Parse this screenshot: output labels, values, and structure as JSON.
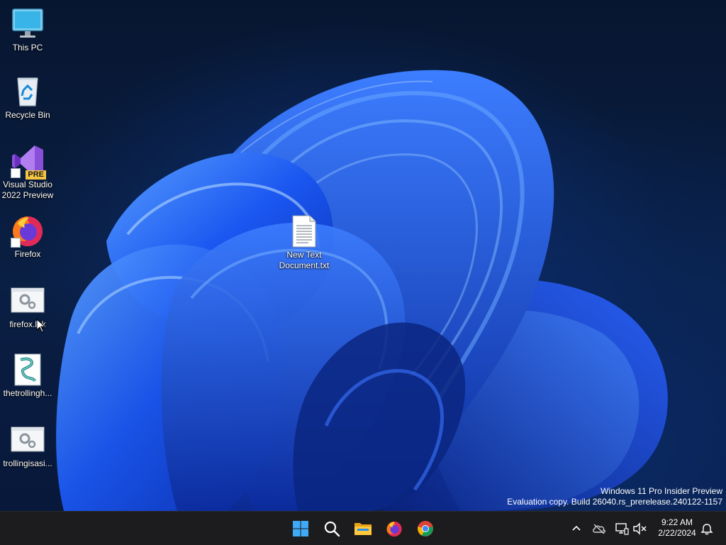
{
  "desktop": {
    "icons": [
      {
        "label": "This PC",
        "icon": "monitor-icon"
      },
      {
        "label": "Recycle Bin",
        "icon": "recycle-bin-icon"
      },
      {
        "label": "Visual Studio\n2022 Preview",
        "icon": "visual-studio-preview-icon",
        "badge": "PRE"
      },
      {
        "label": "Firefox",
        "icon": "firefox-icon"
      },
      {
        "label": "firefox.lnk",
        "icon": "settings-file-icon"
      },
      {
        "label": "thetrollingh...",
        "icon": "script-file-icon"
      },
      {
        "label": "trollingisasi...",
        "icon": "settings-file-icon"
      }
    ],
    "center_file": {
      "label": "New Text\nDocument.txt",
      "icon": "text-document-icon"
    }
  },
  "watermark": {
    "line1": "Windows 11 Pro Insider Preview",
    "line2": "Evaluation copy. Build 26040.rs_prerelease.240122-1157"
  },
  "taskbar": {
    "apps": [
      {
        "name": "Start",
        "icon": "windows-start-icon"
      },
      {
        "name": "Search",
        "icon": "search-icon"
      },
      {
        "name": "File Explorer",
        "icon": "folder-icon"
      },
      {
        "name": "Firefox",
        "icon": "firefox-icon"
      },
      {
        "name": "Chrome",
        "icon": "chrome-icon"
      }
    ],
    "tray": {
      "icons": [
        "chevron-up-icon",
        "onedrive-cloud-icon",
        "network-icon",
        "volume-muted-icon",
        "notification-bell-icon"
      ],
      "time": "9:22 AM",
      "date": "2/22/2024"
    }
  },
  "colors": {
    "taskbar_bg": "#1c1c1e",
    "accent_blue": "#1a5cff",
    "windows_logo": "#3fa9f5"
  }
}
